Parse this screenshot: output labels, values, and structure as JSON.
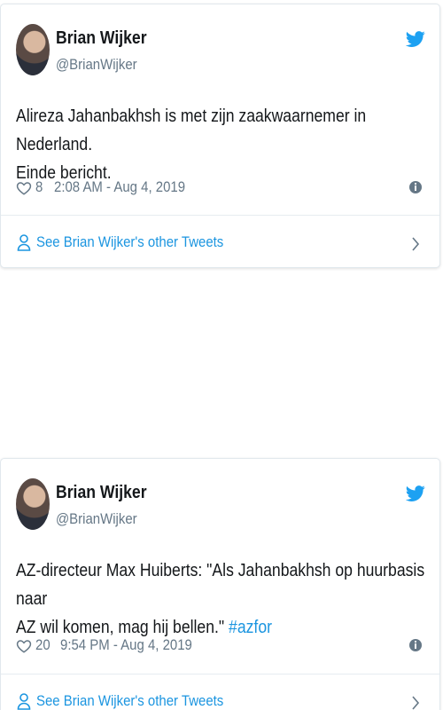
{
  "colors": {
    "link": "#1b95e0",
    "text": "#14171a",
    "muted": "#657786",
    "border": "#e1e8ed"
  },
  "tweets": [
    {
      "name": "Brian Wijker",
      "handle": "@BrianWijker",
      "text_line1": "Alireza Jahanbakhsh is met zijn zaakwaarnemer in Nederland.",
      "text_line2": "Einde bericht.",
      "likes": "8",
      "timestamp": "2:08 AM - Aug 4, 2019",
      "footer_link": "See Brian Wijker's other Tweets",
      "icons": [
        "avatar",
        "twitter-bird-icon",
        "heart-icon",
        "info-icon",
        "person-icon",
        "chevron-right-icon"
      ]
    },
    {
      "name": "Brian Wijker",
      "handle": "@BrianWijker",
      "text_line1": "AZ-directeur Max Huiberts: \"Als Jahanbakhsh op huurbasis naar",
      "text_line2": "AZ wil komen, mag hij bellen.\"",
      "hashtag": "#azfor",
      "likes": "20",
      "timestamp": "9:54 PM - Aug 4, 2019",
      "footer_link": "See Brian Wijker's other Tweets",
      "icons": [
        "avatar",
        "twitter-bird-icon",
        "heart-icon",
        "info-icon",
        "person-icon",
        "chevron-right-icon"
      ]
    }
  ]
}
